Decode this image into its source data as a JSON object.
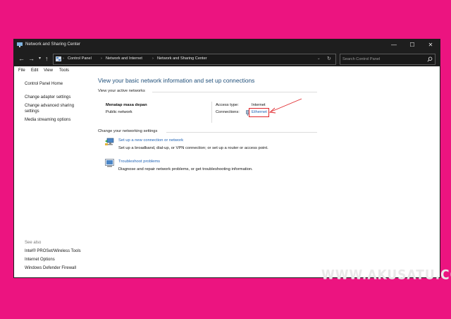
{
  "window": {
    "title": "Network and Sharing Center",
    "controls": {
      "minimize": "—",
      "maximize": "☐",
      "close": "✕"
    }
  },
  "address": {
    "breadcrumb": [
      "Control Panel",
      "Network and Internet",
      "Network and Sharing Center"
    ],
    "search_placeholder": "Search Control Panel"
  },
  "menu": [
    "File",
    "Edit",
    "View",
    "Tools"
  ],
  "sidebar": {
    "home": "Control Panel Home",
    "links": [
      "Change adapter settings",
      "Change advanced sharing settings",
      "Media streaming options"
    ],
    "see_also_title": "See also",
    "see_also": [
      "Intel® PROSet/Wireless Tools",
      "Internet Options",
      "Windows Defender Firewall"
    ]
  },
  "main": {
    "heading": "View your basic network information and set up connections",
    "active_networks_label": "View your active networks",
    "network_name": "Menatap masa depan",
    "network_type": "Public network",
    "access_type_label": "Access type:",
    "access_type_value": "Internet",
    "connections_label": "Connections:",
    "connection_link": "Ethernet",
    "change_settings_label": "Change your networking settings",
    "tasks": [
      {
        "title": "Set up a new connection or network",
        "desc": "Set up a broadband, dial-up, or VPN connection; or set up a router or access point."
      },
      {
        "title": "Troubleshoot problems",
        "desc": "Diagnose and repair network problems, or get troubleshooting information."
      }
    ]
  },
  "watermark": "WWW.AKUSATU.COM",
  "colors": {
    "background": "#ec1480",
    "titlebar": "#1e1e1e",
    "link": "#1e62b5",
    "heading": "#1e4e79",
    "annotation": "#e0262b"
  }
}
